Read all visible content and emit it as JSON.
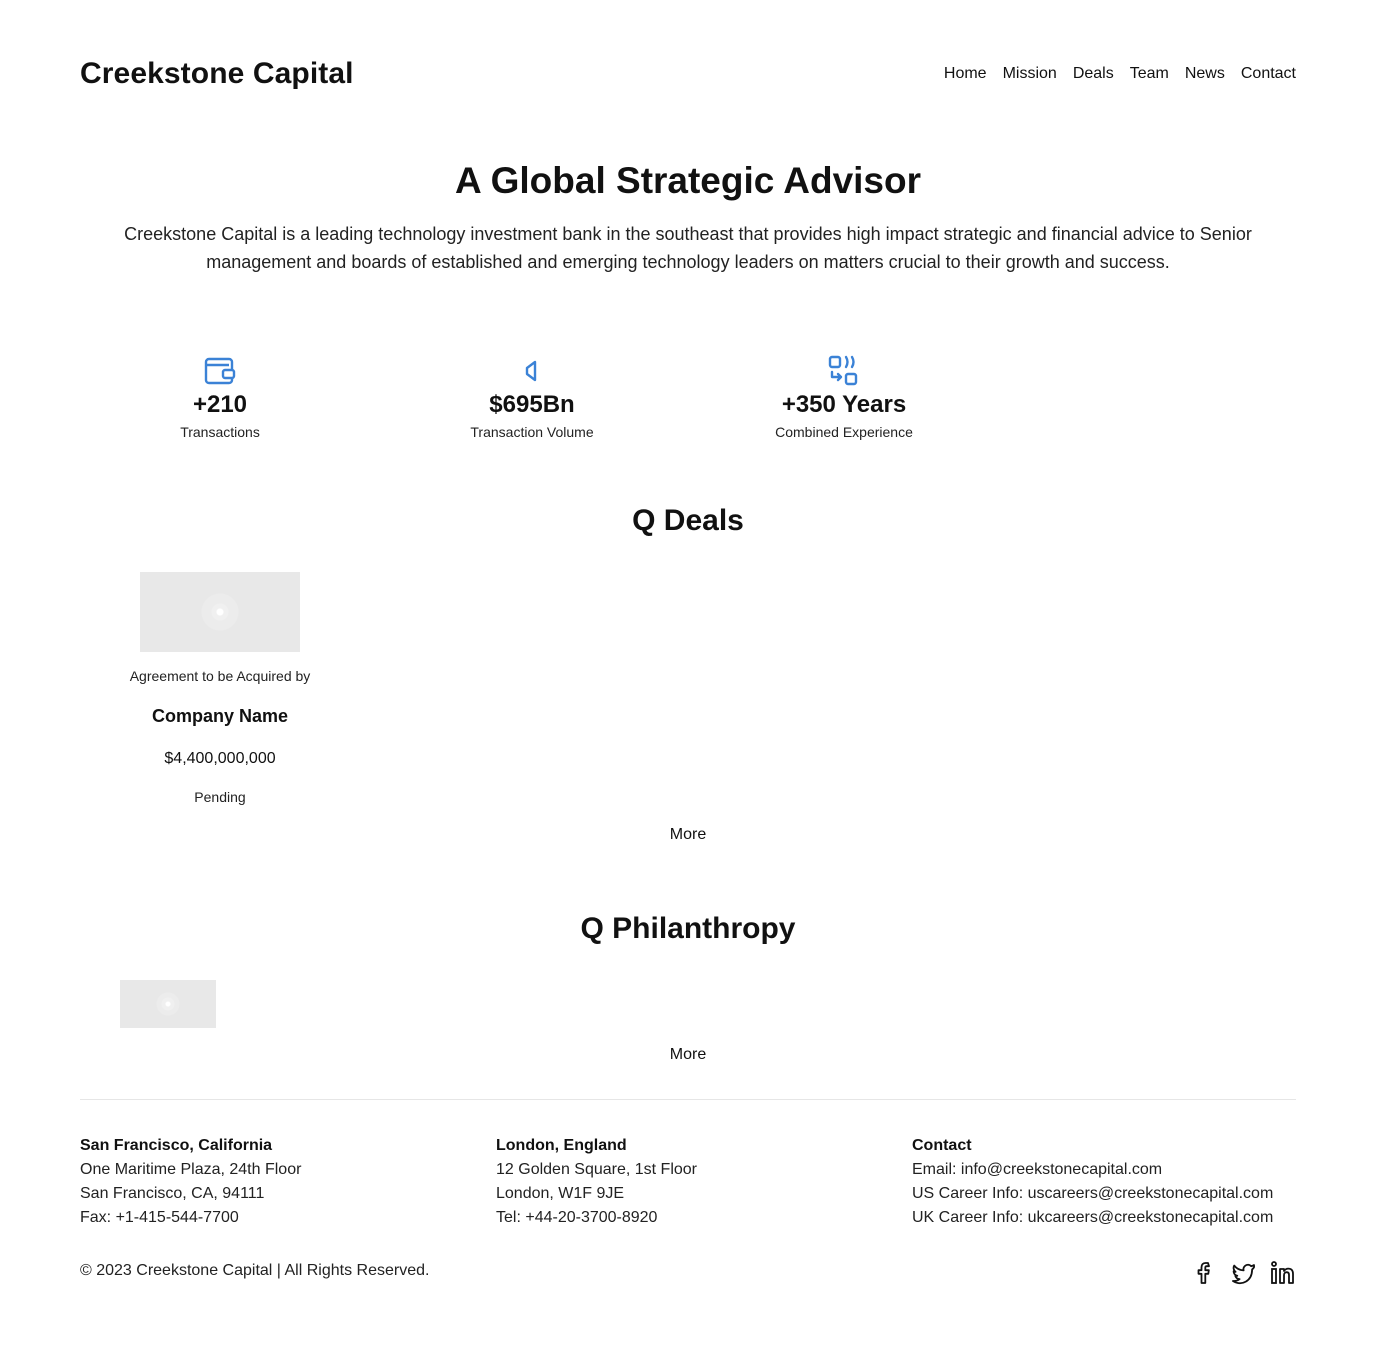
{
  "header": {
    "brand": "Creekstone Capital",
    "nav": [
      "Home",
      "Mission",
      "Deals",
      "Team",
      "News",
      "Contact"
    ]
  },
  "hero": {
    "title": "A Global Strategic Advisor",
    "description": "Creekstone Capital is a leading technology investment bank in the southeast that provides high impact strategic and financial advice to Senior management and boards of established and emerging technology leaders on matters crucial to their growth and success."
  },
  "stats": [
    {
      "icon": "wallet-icon",
      "value": "+210",
      "label": "Transactions"
    },
    {
      "icon": "megaphone-icon",
      "value": "$695Bn",
      "label": "Transaction Volume"
    },
    {
      "icon": "exchange-icon",
      "value": "+350 Years",
      "label": "Combined Experience"
    }
  ],
  "deals": {
    "title": "Q Deals",
    "items": [
      {
        "kicker": "Agreement to be Acquired by",
        "company": "Company Name",
        "amount": "$4,400,000,000",
        "status": "Pending"
      }
    ],
    "more": "More"
  },
  "philanthropy": {
    "title": "Q Philanthropy",
    "more": "More"
  },
  "footer": {
    "sf": {
      "heading": "San Francisco, California",
      "lines": [
        "One Maritime Plaza, 24th Floor",
        "San Francisco, CA, 94111",
        "Fax: +1-415-544-7700"
      ]
    },
    "london": {
      "heading": "London, England",
      "lines": [
        "12 Golden Square, 1st Floor",
        "London, W1F 9JE",
        "Tel: +44-20-3700-8920"
      ]
    },
    "contact": {
      "heading": "Contact",
      "lines": [
        "Email: info@creekstonecapital.com",
        "US Career Info: uscareers@creekstonecapital.com",
        "UK Career Info: ukcareers@creekstonecapital.com"
      ]
    },
    "copyright": "© 2023 Creekstone Capital | All Rights Reserved.",
    "social": [
      "facebook-icon",
      "twitter-icon",
      "linkedin-icon"
    ]
  },
  "colors": {
    "accent": "#3b82d6",
    "placeholder": "#e8e8e8",
    "divider": "#e6e6e6"
  }
}
